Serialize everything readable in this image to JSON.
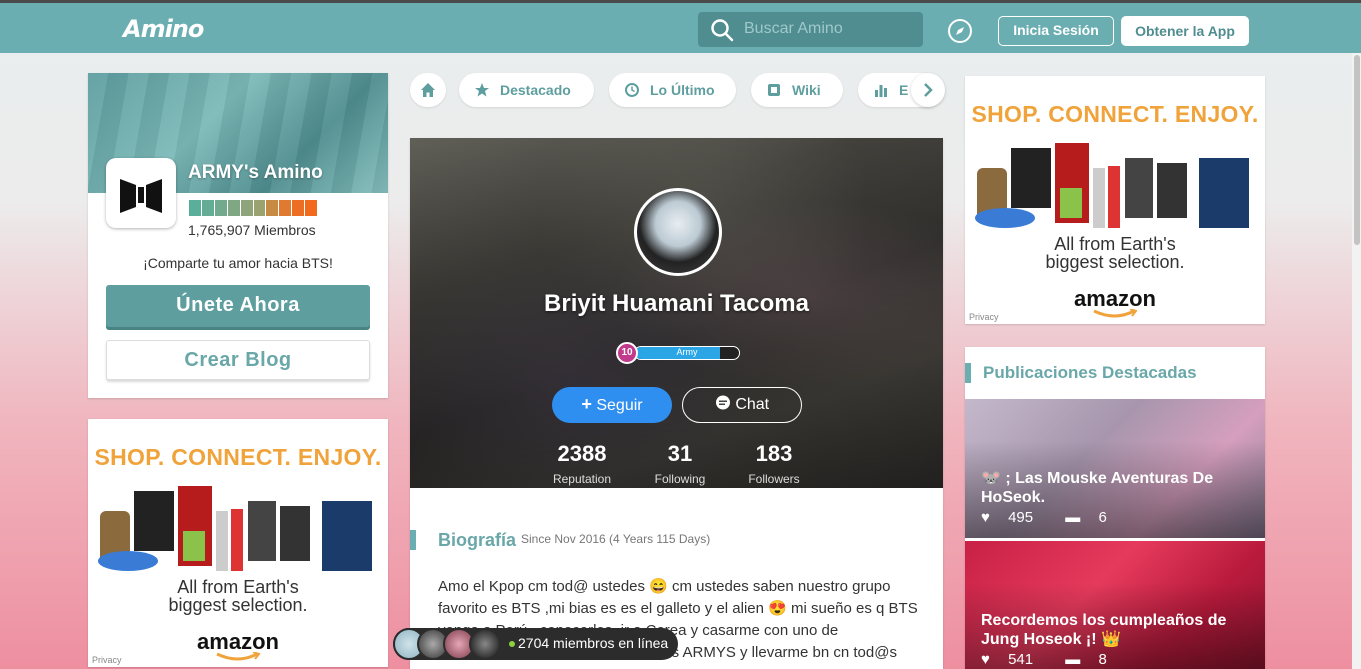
{
  "header": {
    "logo": "Amino",
    "search_placeholder": "Buscar Amino",
    "login_label": "Inicia Sesión",
    "get_app_label": "Obtener la App"
  },
  "community": {
    "name": "ARMY's Amino",
    "members": "1,765,907 Miembros",
    "tagline": "¡Comparte tu amor hacia BTS!",
    "join_label": "Únete Ahora",
    "create_blog_label": "Crear Blog",
    "level_colors": [
      "#5aaf9a",
      "#64ad94",
      "#72aa8e",
      "#80a784",
      "#8ea47a",
      "#9ca170",
      "#c78a45",
      "#e07a30",
      "#ec6e23",
      "#f26a1c"
    ]
  },
  "nav": {
    "tabs": [
      {
        "label": "Destacado",
        "icon": "star-icon"
      },
      {
        "label": "Lo Último",
        "icon": "clock-icon"
      },
      {
        "label": "Wiki",
        "icon": "wiki-icon"
      },
      {
        "label": "E",
        "icon": "bar-chart-icon"
      }
    ]
  },
  "profile": {
    "name": "Briyit Huamani Tacoma",
    "level": "10",
    "level_title": "Army",
    "level_progress": 0.82,
    "follow_label": "Seguir",
    "chat_label": "Chat",
    "stats": [
      {
        "value": "2388",
        "label": "Reputation"
      },
      {
        "value": "31",
        "label": "Following"
      },
      {
        "value": "183",
        "label": "Followers"
      }
    ],
    "bio_title": "Biografía",
    "bio_since": "Since Nov 2016 (4 Years 115 Days)",
    "bio_text": "Amo el Kpop cm tod@ ustedes 😄 cm ustedes saben nuestro grupo favorito es BTS ,mi bias es es el galleto y el alien 😍 mi sueño es q BTS venga a Perú , conocerlos, ir a Corea y casarme con uno de ellos.Espero conocer a ma much@s ARMYS y llevarme bn cn tod@s"
  },
  "online": {
    "count": "2704",
    "text": "miembros en línea"
  },
  "ads": {
    "title": "SHOP. CONNECT. ENJOY.",
    "line1": "All from Earth's",
    "line2": "biggest selection.",
    "brand": "amazon",
    "privacy": "Privacy"
  },
  "featured": {
    "title": "Publicaciones Destacadas",
    "posts": [
      {
        "title": "🐭 ; Las Mouske Aventuras De HoSeok.",
        "likes": "495",
        "comments": "6"
      },
      {
        "title": "Recordemos los cumpleaños de Jung Hoseok ¡! 👑",
        "likes": "541",
        "comments": "8"
      }
    ]
  }
}
